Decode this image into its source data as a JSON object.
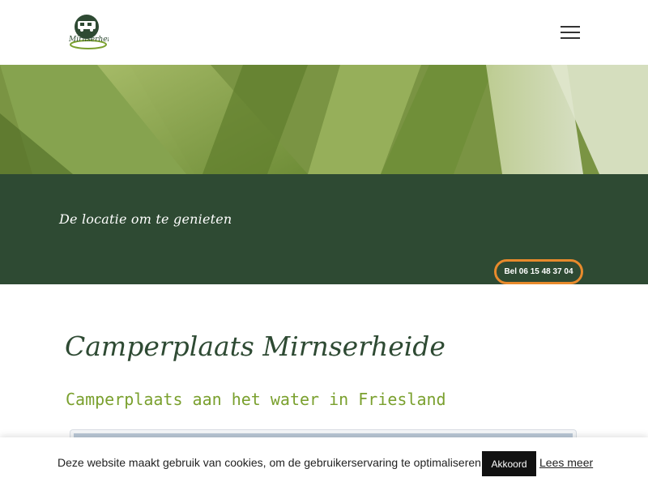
{
  "header": {
    "logo_icon": "camper-logo-icon",
    "logo_text": "Mirnserheide",
    "menu_icon": "hamburger-menu-icon"
  },
  "hero": {
    "tagline": "De locatie om te genieten",
    "call_button": "Bel 06 15 48 37 04"
  },
  "main": {
    "title": "Camperplaats Mirnserheide",
    "subtitle": "Camperplaats aan het water in Friesland"
  },
  "cookie": {
    "text": "Deze website maakt gebruik van cookies, om de gebruikerservaring te optimaliseren.",
    "accept_label": "Akkoord",
    "more_label": "Lees meer"
  },
  "colors": {
    "dark_green": "#2e4a33",
    "accent_orange": "#e88a2c",
    "light_green": "#7aa02e"
  }
}
